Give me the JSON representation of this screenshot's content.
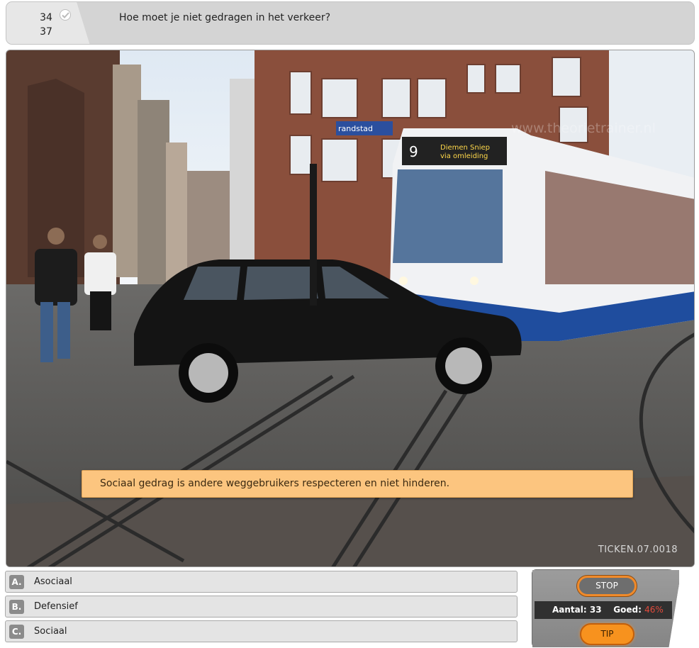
{
  "header": {
    "counter_current": "34",
    "counter_total": "37",
    "question": "Hoe moet je niet gedragen in het verkeer?"
  },
  "photo": {
    "feedback": "Sociaal gedrag is andere weggebruikers respecteren en niet hinderen.",
    "image_code": "TICKEN.07.0018",
    "tram_destination_line1": "Diemen Sniep",
    "tram_destination_line2": "via omleiding",
    "tram_number": "9",
    "watermark": "www.theorietrainer.nl",
    "sign_text": "randstad"
  },
  "answers": [
    {
      "letter": "A.",
      "text": "Asociaal"
    },
    {
      "letter": "B.",
      "text": "Defensief"
    },
    {
      "letter": "C.",
      "text": "Sociaal"
    }
  ],
  "control": {
    "stop_label": "STOP",
    "count_label": "Aantal:",
    "count_value": "33",
    "good_label": "Goed:",
    "good_value": "46%",
    "tip_label": "TIP"
  },
  "colors": {
    "feedback_bg": "#fcc57f",
    "button_orange": "#f7921e",
    "percent_red": "#e04a3b",
    "tram_blue": "#1f4d9e"
  },
  "icons": [
    "check-icon"
  ]
}
